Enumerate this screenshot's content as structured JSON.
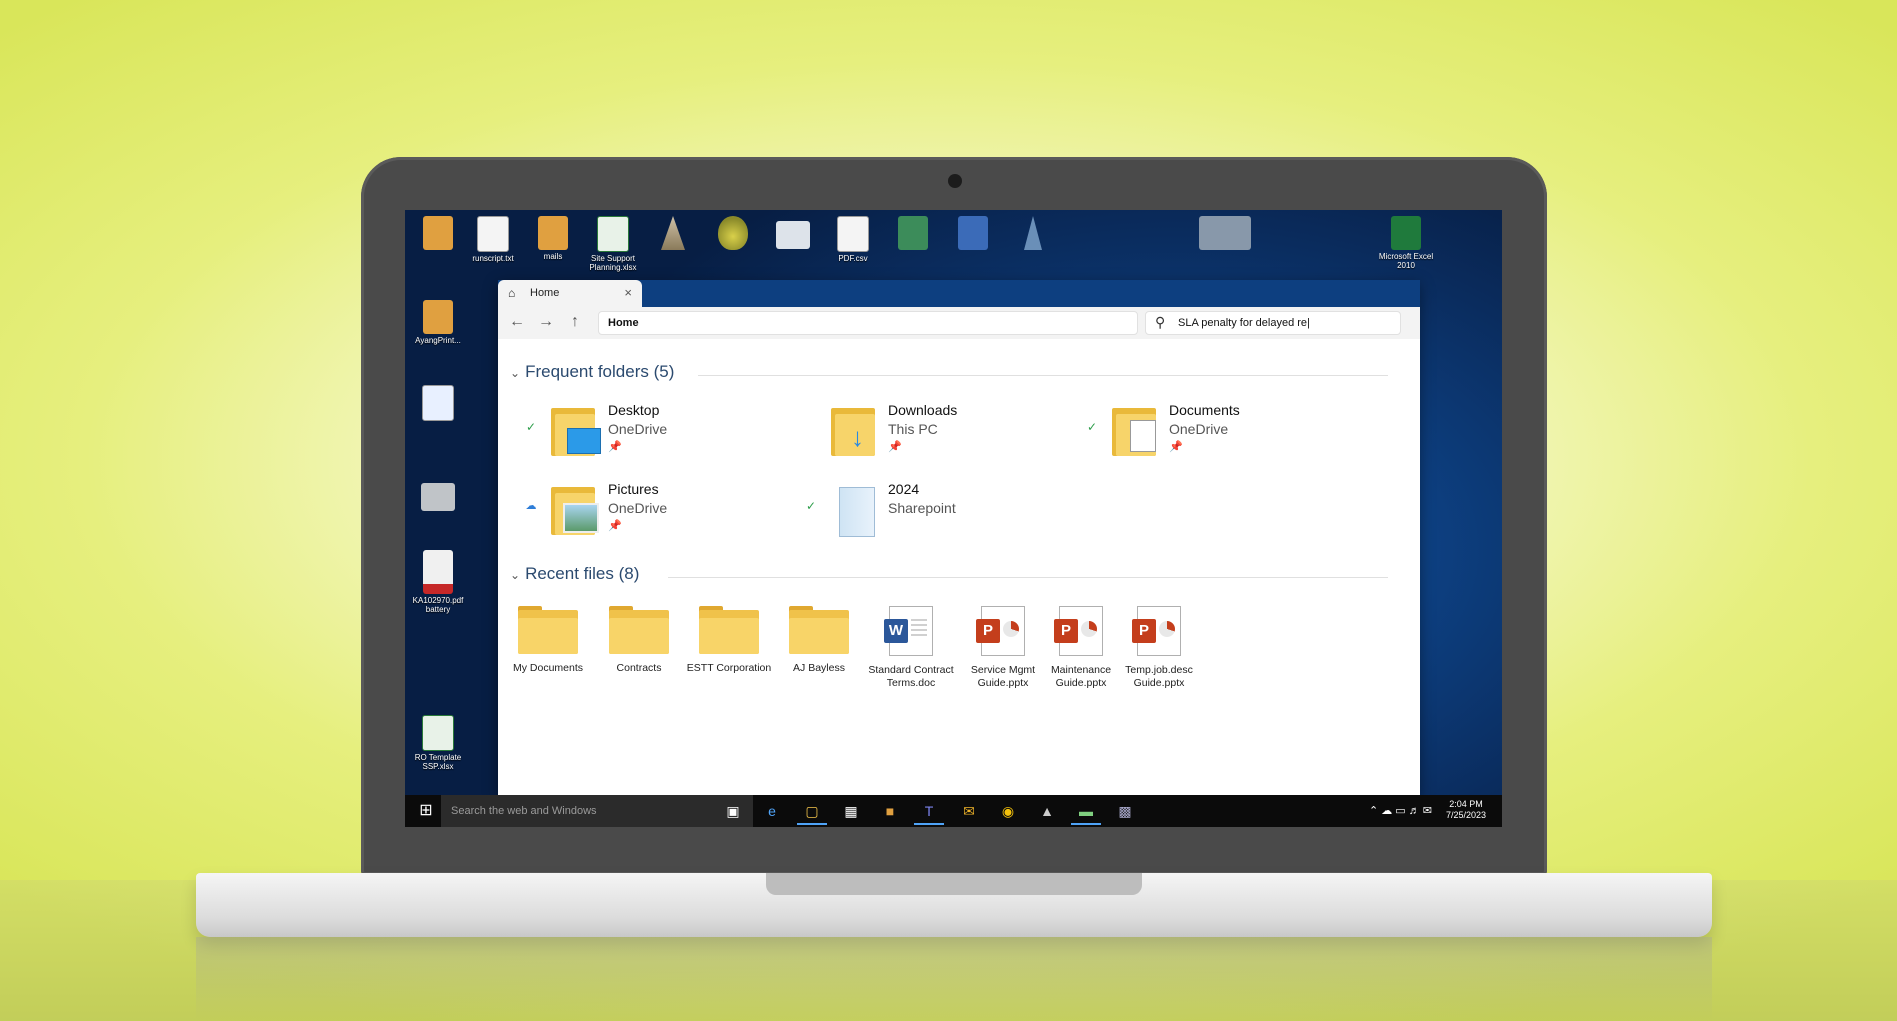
{
  "window": {
    "tab_title": "Home",
    "address": "Home",
    "search_value": "SLA penalty for delayed re|"
  },
  "frequent": {
    "heading": "Frequent folders (5)",
    "items": [
      {
        "name": "Desktop",
        "location": "OneDrive",
        "status": "synced"
      },
      {
        "name": "Downloads",
        "location": "This PC",
        "status": "none"
      },
      {
        "name": "Documents",
        "location": "OneDrive",
        "status": "synced"
      },
      {
        "name": "Pictures",
        "location": "OneDrive",
        "status": "cloud"
      },
      {
        "name": "2024",
        "location": "Sharepoint",
        "status": "synced"
      }
    ]
  },
  "recent": {
    "heading": "Recent files (8)",
    "items": [
      {
        "name": "My Documents",
        "type": "folder"
      },
      {
        "name": "Contracts",
        "type": "folder"
      },
      {
        "name": "ESTT Corporation",
        "type": "folder"
      },
      {
        "name": "AJ Bayless",
        "type": "folder"
      },
      {
        "name": "Standard Contract Terms.doc",
        "type": "word"
      },
      {
        "name": "Service Mgmt Guide.pptx",
        "type": "powerpoint"
      },
      {
        "name": "Maintenance Guide.pptx",
        "type": "powerpoint"
      },
      {
        "name": "Temp.job.desc Guide.pptx",
        "type": "powerpoint"
      }
    ]
  },
  "desktop_icons": [
    {
      "label": "runscript.txt"
    },
    {
      "label": "mails"
    },
    {
      "label": "Site Support Planning.xlsx"
    },
    {
      "label": "PDF.csv"
    },
    {
      "label": "Microsoft Excel 2010"
    },
    {
      "label": "AyangPrint..."
    },
    {
      "label": "KA102970.pdf battery"
    },
    {
      "label": "RO Template SSP.xlsx"
    }
  ],
  "taskbar": {
    "search_placeholder": "Search the web and Windows",
    "time": "2:04 PM",
    "date": "7/25/2023"
  },
  "colors": {
    "accent": "#2b4a6f",
    "synced": "#2e9e4c",
    "cloud": "#2f7ed8"
  }
}
